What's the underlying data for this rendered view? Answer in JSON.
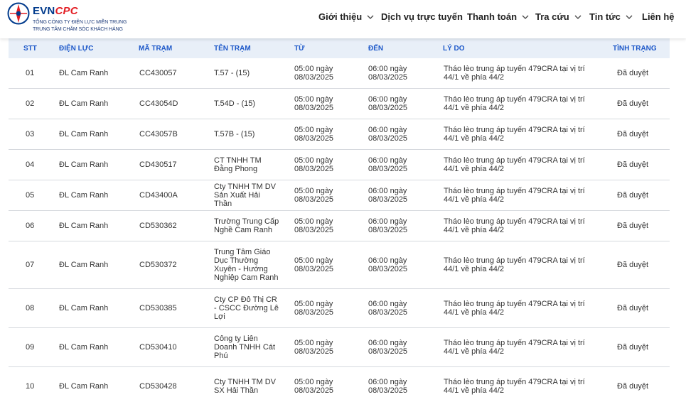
{
  "brand": {
    "evn": "EVN",
    "cpc": "CPC",
    "line1": "TỔNG CÔNG TY ĐIỆN LỰC MIỀN TRUNG",
    "line2": "TRUNG TÂM CHĂM SÓC KHÁCH HÀNG",
    "colors": {
      "blue": "#003a8c",
      "red": "#e31e24",
      "accent": "#1d58c9"
    }
  },
  "nav": [
    {
      "label": "Giới thiệu",
      "has_dropdown": true
    },
    {
      "label": "Dịch vụ trực tuyến",
      "has_dropdown": false
    },
    {
      "label": "Thanh toán",
      "has_dropdown": true
    },
    {
      "label": "Tra cứu",
      "has_dropdown": true
    },
    {
      "label": "Tin tức",
      "has_dropdown": true
    },
    {
      "label": "Liên hệ",
      "has_dropdown": false
    }
  ],
  "table": {
    "headers": [
      "STT",
      "ĐIỆN LỰC",
      "MÃ TRẠM",
      "TÊN TRẠM",
      "TỪ",
      "ĐẾN",
      "LÝ DO",
      "TÌNH TRẠNG"
    ],
    "rows": [
      {
        "stt": "01",
        "dien_luc": "ĐL Cam Ranh",
        "ma_tram": "CC430057",
        "ten_tram": "T.57 - (15)",
        "tu": "05:00 ngày 08/03/2025",
        "den": "06:00 ngày 08/03/2025",
        "ly_do": "Tháo lèo trung áp tuyến 479CRA tại vị trí 44/1 về phía 44/2",
        "tinh_trang": "Đã duyệt"
      },
      {
        "stt": "02",
        "dien_luc": "ĐL Cam Ranh",
        "ma_tram": "CC43054D",
        "ten_tram": "T.54D - (15)",
        "tu": "05:00 ngày 08/03/2025",
        "den": "06:00 ngày 08/03/2025",
        "ly_do": "Tháo lèo trung áp tuyến 479CRA tại vị trí 44/1 về phía 44/2",
        "tinh_trang": "Đã duyệt"
      },
      {
        "stt": "03",
        "dien_luc": "ĐL Cam Ranh",
        "ma_tram": "CC43057B",
        "ten_tram": "T.57B - (15)",
        "tu": "05:00 ngày 08/03/2025",
        "den": "06:00 ngày 08/03/2025",
        "ly_do": "Tháo lèo trung áp tuyến 479CRA tại vị trí 44/1 về phía 44/2",
        "tinh_trang": "Đã duyệt"
      },
      {
        "stt": "04",
        "dien_luc": "ĐL Cam Ranh",
        "ma_tram": "CD430517",
        "ten_tram": "CT TNHH TM Đằng Phong",
        "tu": "05:00 ngày 08/03/2025",
        "den": "06:00 ngày 08/03/2025",
        "ly_do": "Tháo lèo trung áp tuyến 479CRA tại vị trí 44/1 về phía 44/2",
        "tinh_trang": "Đã duyệt"
      },
      {
        "stt": "05",
        "dien_luc": "ĐL Cam Ranh",
        "ma_tram": "CD43400A",
        "ten_tram": "Cty TNHH TM DV Sản Xuất Hải Thần",
        "tu": "05:00 ngày 08/03/2025",
        "den": "06:00 ngày 08/03/2025",
        "ly_do": "Tháo lèo trung áp tuyến 479CRA tại vị trí 44/1 về phía 44/2",
        "tinh_trang": "Đã duyệt"
      },
      {
        "stt": "06",
        "dien_luc": "ĐL Cam Ranh",
        "ma_tram": "CD530362",
        "ten_tram": "Trường Trung Cấp Nghề Cam Ranh",
        "tu": "05:00 ngày 08/03/2025",
        "den": "06:00 ngày 08/03/2025",
        "ly_do": "Tháo lèo trung áp tuyến 479CRA tại vị trí 44/1 về phía 44/2",
        "tinh_trang": "Đã duyệt"
      },
      {
        "stt": "07",
        "dien_luc": "ĐL Cam Ranh",
        "ma_tram": "CD530372",
        "ten_tram": "Trung Tâm Giáo Dục Thường Xuyên - Hướng Nghiệp Cam Ranh",
        "tu": "05:00 ngày 08/03/2025",
        "den": "06:00 ngày 08/03/2025",
        "ly_do": "Tháo lèo trung áp tuyến 479CRA tại vị trí 44/1 về phía 44/2",
        "tinh_trang": "Đã duyệt"
      },
      {
        "stt": "08",
        "dien_luc": "ĐL Cam Ranh",
        "ma_tram": "CD530385",
        "ten_tram": "Cty CP Đô Thị CR - CSCC Đường Lê Lợi",
        "tu": "05:00 ngày 08/03/2025",
        "den": "06:00 ngày 08/03/2025",
        "ly_do": "Tháo lèo trung áp tuyến 479CRA tại vị trí 44/1 về phía 44/2",
        "tinh_trang": "Đã duyệt"
      },
      {
        "stt": "09",
        "dien_luc": "ĐL Cam Ranh",
        "ma_tram": "CD530410",
        "ten_tram": "Công ty Liên Doanh TNHH Cát Phú",
        "tu": "05:00 ngày 08/03/2025",
        "den": "06:00 ngày 08/03/2025",
        "ly_do": "Tháo lèo trung áp tuyến 479CRA tại vị trí 44/1 về phía 44/2",
        "tinh_trang": "Đã duyệt"
      },
      {
        "stt": "10",
        "dien_luc": "ĐL Cam Ranh",
        "ma_tram": "CD530428",
        "ten_tram": "Cty TNHH TM DV SX Hải Thần",
        "tu": "05:00 ngày 08/03/2025",
        "den": "06:00 ngày 08/03/2025",
        "ly_do": "Tháo lèo trung áp tuyến 479CRA tại vị trí 44/1 về phía 44/2",
        "tinh_trang": "Đã duyệt"
      }
    ]
  }
}
